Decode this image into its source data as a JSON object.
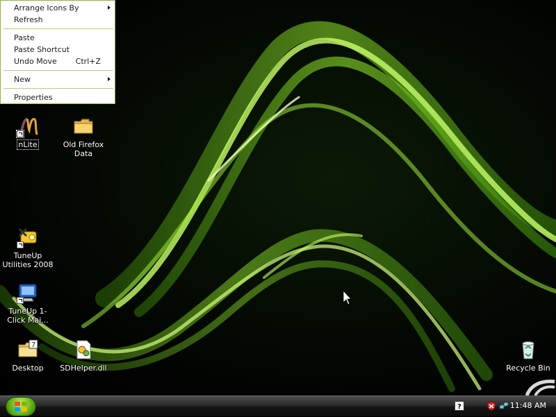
{
  "context_menu": {
    "items": [
      {
        "label": "Arrange Icons By",
        "submenu": true
      },
      {
        "label": "Refresh"
      },
      {
        "label": "Paste"
      },
      {
        "label": "Paste Shortcut"
      },
      {
        "label": "Undo Move",
        "shortcut": "Ctrl+Z"
      },
      {
        "label": "New",
        "submenu": true
      },
      {
        "label": "Properties"
      }
    ]
  },
  "desktop_icons": [
    {
      "label": "nLite",
      "icon": "nlite-icon"
    },
    {
      "label": "Old Firefox Data",
      "icon": "folder-icon"
    },
    {
      "label": "TuneUp Utilities 2008",
      "icon": "tuneup-icon"
    },
    {
      "label": "TuneUp 1-Click Mai...",
      "icon": "tuneup-1click-icon"
    },
    {
      "label": "Desktop",
      "icon": "folder-icon"
    },
    {
      "label": "SDHelper.dll",
      "icon": "dll-icon"
    },
    {
      "label": "Recycle Bin",
      "icon": "recycle-bin-icon"
    }
  ],
  "taskbar": {
    "clock": "11:48 AM",
    "tray_icons": [
      "help-icon",
      "security-shield-icon",
      "network-icon"
    ]
  },
  "colors": {
    "wallpaper_accent": "#7fd11a",
    "menu_border": "#8ab43c"
  }
}
